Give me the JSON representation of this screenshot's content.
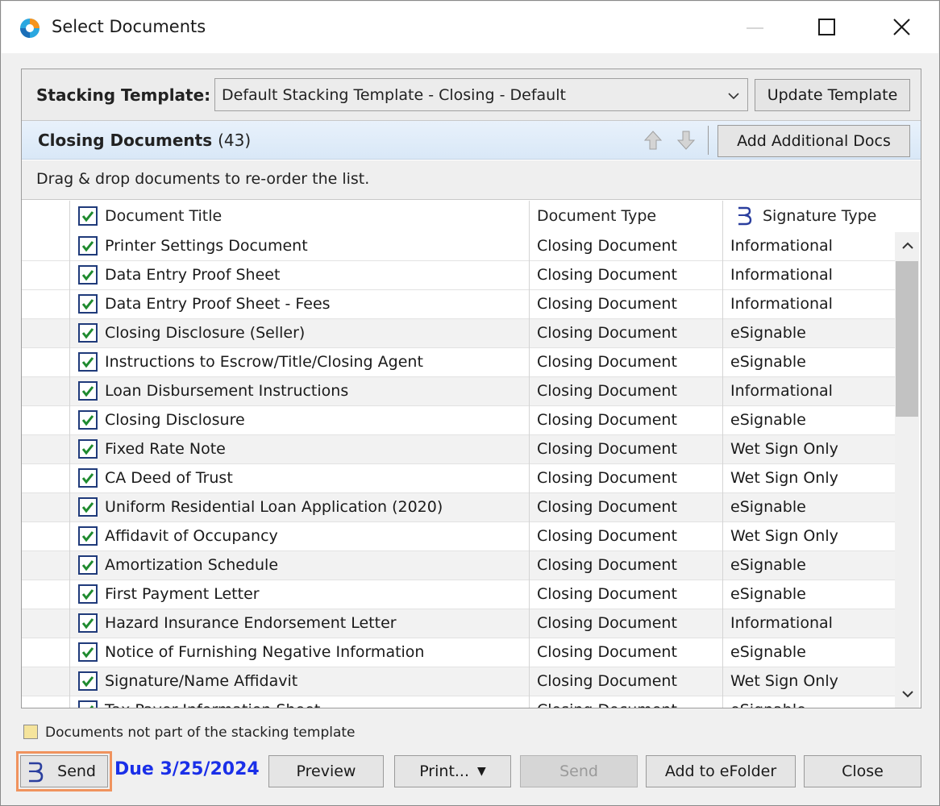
{
  "window": {
    "title": "Select Documents"
  },
  "template": {
    "label": "Stacking Template:",
    "selected": "Default Stacking Template - Closing - Default",
    "update_label": "Update Template"
  },
  "docs": {
    "title": "Closing Documents",
    "count": "(43)",
    "add_label": "Add Additional Docs",
    "hint": "Drag & drop documents to re-order the list."
  },
  "columns": {
    "title": "Document Title",
    "type": "Document Type",
    "signature": "Signature Type"
  },
  "rows": [
    {
      "title": "Printer Settings Document",
      "type": "Closing Document",
      "sig": "Informational"
    },
    {
      "title": "Data Entry Proof Sheet",
      "type": "Closing Document",
      "sig": "Informational"
    },
    {
      "title": "Data Entry Proof Sheet - Fees",
      "type": "Closing Document",
      "sig": "Informational"
    },
    {
      "title": "Closing Disclosure (Seller)",
      "type": "Closing Document",
      "sig": "eSignable"
    },
    {
      "title": "Instructions to Escrow/Title/Closing Agent",
      "type": "Closing Document",
      "sig": "eSignable"
    },
    {
      "title": "Loan Disbursement Instructions",
      "type": "Closing Document",
      "sig": "Informational"
    },
    {
      "title": "Closing Disclosure",
      "type": "Closing Document",
      "sig": "eSignable"
    },
    {
      "title": "Fixed Rate Note",
      "type": "Closing Document",
      "sig": "Wet Sign Only"
    },
    {
      "title": "CA Deed of Trust",
      "type": "Closing Document",
      "sig": "Wet Sign Only"
    },
    {
      "title": "Uniform Residential Loan Application (2020)",
      "type": "Closing Document",
      "sig": "eSignable"
    },
    {
      "title": "Affidavit of Occupancy",
      "type": "Closing Document",
      "sig": "Wet Sign Only"
    },
    {
      "title": "Amortization Schedule",
      "type": "Closing Document",
      "sig": "eSignable"
    },
    {
      "title": "First Payment Letter",
      "type": "Closing Document",
      "sig": "eSignable"
    },
    {
      "title": "Hazard Insurance Endorsement Letter",
      "type": "Closing Document",
      "sig": "Informational"
    },
    {
      "title": "Notice of Furnishing Negative Information",
      "type": "Closing Document",
      "sig": "eSignable"
    },
    {
      "title": "Signature/Name Affidavit",
      "type": "Closing Document",
      "sig": "Wet Sign Only"
    },
    {
      "title": "Tax Payer Information Sheet",
      "type": "Closing Document",
      "sig": "eSignable"
    }
  ],
  "legend": {
    "text": "Documents not part of the stacking template",
    "swatch_color": "#f5e49c"
  },
  "footer": {
    "send_label": "Send",
    "due_text": "Due 3/25/2024",
    "preview_label": "Preview",
    "print_label": "Print...",
    "send_disabled_label": "Send",
    "efolder_label": "Add to eFolder",
    "close_label": "Close"
  },
  "colors": {
    "accent_due": "#1a2fe8",
    "highlight": "#f0935e",
    "check": "#1e8a2e"
  }
}
